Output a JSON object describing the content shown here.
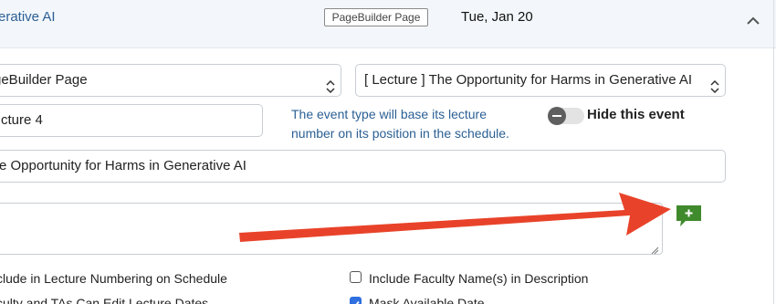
{
  "header": {
    "title": "erative AI",
    "type_badge": "PageBuilder Page",
    "date": "Tue, Jan 20",
    "collapse_icon": "chevron-up-icon"
  },
  "form": {
    "page_type_select": "geBuilder Page",
    "lecture_select": "[ Lecture ] The Opportunity for Harms in Generative AI",
    "lecture_number": "cture 4",
    "lecture_number_note": "The event type will base its lecture number on its position in the schedule.",
    "hide_event_label": "Hide this event",
    "hide_event_on": false,
    "title_value": "e Opportunity for Harms in Generative AI",
    "description_value": "",
    "add_comment_icon": "add-comment-icon"
  },
  "checkboxes": [
    {
      "label": "clude in Lecture Numbering on Schedule",
      "checked": false
    },
    {
      "label": "Include Faculty Name(s) in Description",
      "checked": false
    },
    {
      "label": "culty and TAs Can Edit Lecture Dates",
      "checked": false
    },
    {
      "label": "Mask Available Date",
      "checked": true
    }
  ],
  "annotation": {
    "arrow_color": "#e8432a",
    "accent_color": "#2b5f94",
    "add_button_color": "#3f8a2c"
  }
}
